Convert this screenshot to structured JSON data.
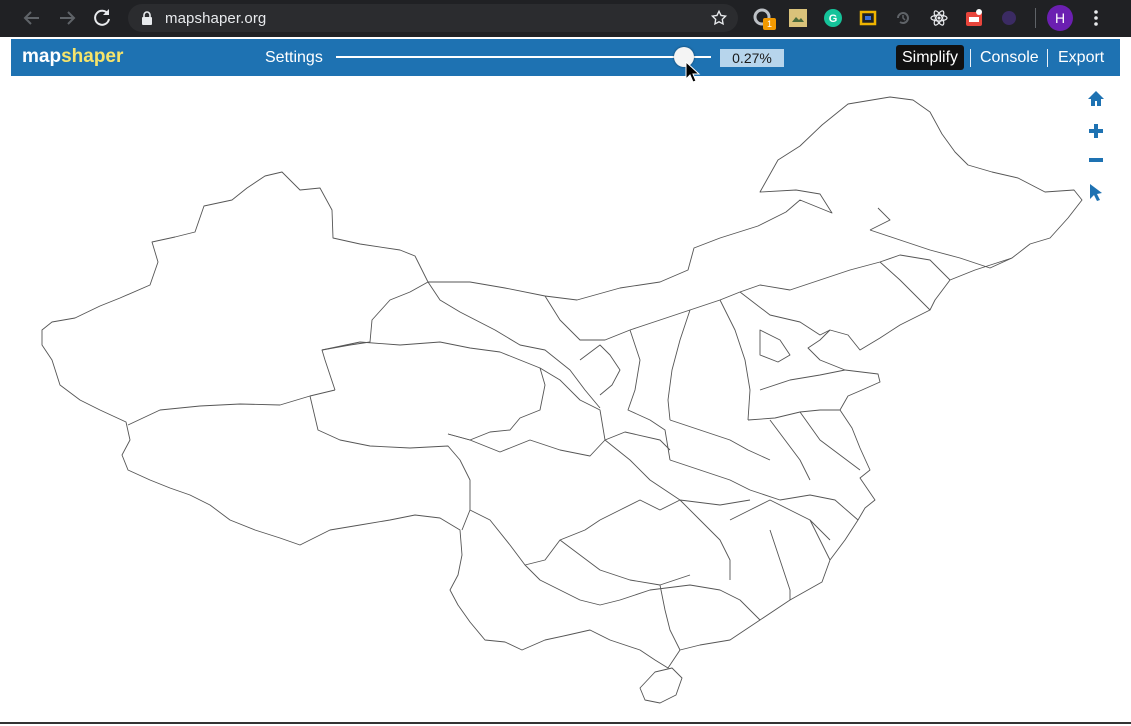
{
  "browser": {
    "url": "mapshaper.org",
    "extension_badge": "1",
    "profile_initial": "H"
  },
  "app": {
    "logo_map": "map",
    "logo_shaper": "shaper",
    "settings_label": "Settings",
    "simplify_percent": "0.27%",
    "simplify_slider_fraction": 0.9,
    "menu": {
      "simplify": "Simplify",
      "console": "Console",
      "export": "Export"
    }
  },
  "colors": {
    "header": "#1e72b2",
    "logo_accent": "#f6e46b",
    "browser": "#202124",
    "tool_icons": "#1e72b2"
  },
  "icons": [
    "back-icon",
    "forward-icon",
    "reload-icon",
    "lock-icon",
    "star-icon",
    "home-icon",
    "zoom-in-icon",
    "zoom-out-icon",
    "pointer-icon"
  ]
}
